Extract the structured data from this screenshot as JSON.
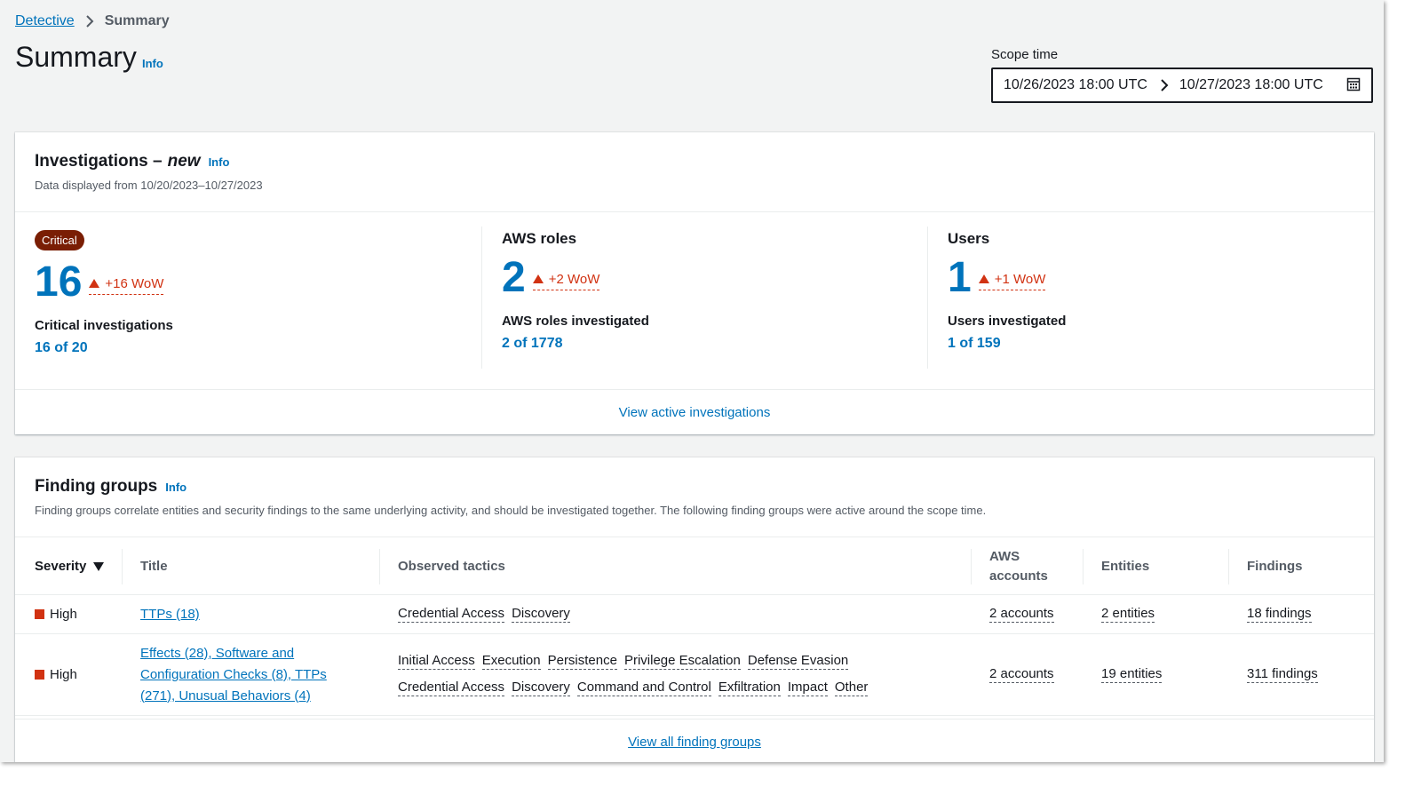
{
  "breadcrumb": {
    "parent": "Detective",
    "current": "Summary"
  },
  "header": {
    "title": "Summary",
    "info": "Info"
  },
  "scope": {
    "label": "Scope time",
    "start": "10/26/2023 18:00 UTC",
    "end": "10/27/2023 18:00 UTC"
  },
  "investigations": {
    "title": "Investigations –",
    "title_em": "new",
    "info": "Info",
    "desc": "Data displayed from 10/20/2023–10/27/2023",
    "critical": {
      "badge": "Critical",
      "count": "16",
      "wow": "+16 WoW",
      "label": "Critical investigations",
      "ratio": "16 of 20"
    },
    "roles": {
      "head": "AWS roles",
      "count": "2",
      "wow": "+2 WoW",
      "label": "AWS roles investigated",
      "ratio": "2 of 1778"
    },
    "users": {
      "head": "Users",
      "count": "1",
      "wow": "+1 WoW",
      "label": "Users investigated",
      "ratio": "1 of 159"
    },
    "footer_link": "View active investigations"
  },
  "finding_groups": {
    "title": "Finding groups",
    "info": "Info",
    "desc": "Finding groups correlate entities and security findings to the same underlying activity, and should be investigated together. The following finding groups were active around the scope time.",
    "columns": {
      "severity": "Severity",
      "title": "Title",
      "tactics": "Observed tactics",
      "accounts_1": "AWS",
      "accounts_2": "accounts",
      "entities": "Entities",
      "findings": "Findings"
    },
    "rows": [
      {
        "severity": "High",
        "title": "TTPs (18)",
        "tactics": [
          "Credential Access",
          "Discovery"
        ],
        "accounts": "2 accounts",
        "entities": "2 entities",
        "findings": "18 findings"
      },
      {
        "severity": "High",
        "title_lines": [
          "Effects (28), Software and",
          "Configuration Checks (8), TTPs",
          "(271), Unusual Behaviors (4)"
        ],
        "tactics_line1": [
          "Initial Access",
          "Execution",
          "Persistence",
          "Privilege Escalation",
          "Defense Evasion"
        ],
        "tactics_line2": [
          "Credential Access",
          "Discovery",
          "Command and Control",
          "Exfiltration",
          "Impact",
          "Other"
        ],
        "accounts": "2 accounts",
        "entities": "19 entities",
        "findings": "311 findings"
      }
    ],
    "footer_link": "View all finding groups"
  },
  "colors": {
    "link": "#0073bb",
    "critical": "#7a1e04",
    "alert": "#d13212"
  }
}
